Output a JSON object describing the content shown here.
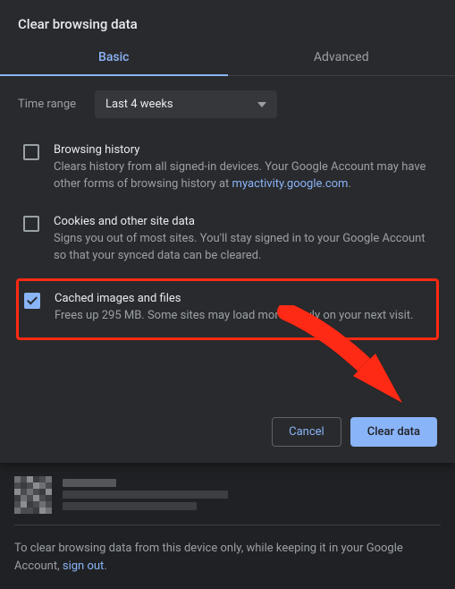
{
  "dialog": {
    "title": "Clear browsing data",
    "tabs": {
      "basic": "Basic",
      "advanced": "Advanced"
    },
    "time_range_label": "Time range",
    "time_range_value": "Last 4 weeks",
    "options": {
      "history": {
        "title": "Browsing history",
        "desc_prefix": "Clears history from all signed-in devices. Your Google Account may have other forms of browsing history at ",
        "desc_link": "myactivity.google.com",
        "desc_suffix": "."
      },
      "cookies": {
        "title": "Cookies and other site data",
        "desc": "Signs you out of most sites. You'll stay signed in to your Google Account so that your synced data can be cleared."
      },
      "cache": {
        "title": "Cached images and files",
        "desc": "Frees up 295 MB. Some sites may load more slowly on your next visit."
      }
    },
    "buttons": {
      "cancel": "Cancel",
      "clear": "Clear data"
    }
  },
  "footer_note": {
    "prefix": "To clear browsing data from this device only, while keeping it in your Google Account, ",
    "link": "sign out",
    "suffix": "."
  }
}
